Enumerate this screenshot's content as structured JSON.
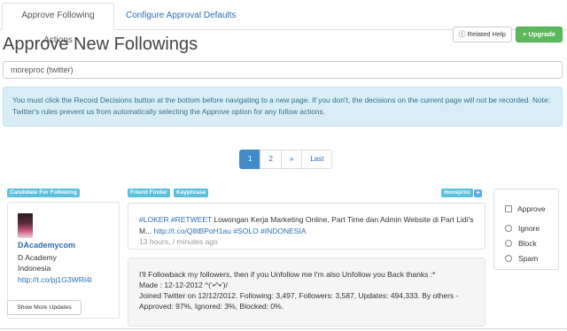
{
  "tabs": [
    {
      "label": "Approve Following Actions",
      "active": true
    },
    {
      "label": "Configure Approval Defaults",
      "active": false
    }
  ],
  "page_title": "Approve New Followings",
  "buttons": {
    "related_help": "Related Help",
    "upgrade": "Upgrade"
  },
  "account_select": {
    "value": "moreproc (twitter)"
  },
  "alert_text": "You must click the Record Decisions button at the bottom before navigating to a new page. If you don't, the decisions on the current page will not be recorded. Note: Twitter's rules prevent us from automatically selecting the Approve option for any follow actions.",
  "pagination": {
    "current": "1",
    "next_page": "2",
    "next": "»",
    "last": "Last"
  },
  "labels": {
    "candidate": "Candidate For Following",
    "friend_finder": "Friend Finder",
    "keyphrase": "Keyphrase",
    "account": "moreproc"
  },
  "candidate": {
    "screen_name": "DAcademycom",
    "name": "D Academy",
    "location": "Indonesia",
    "url": "http://t.co/pj1G3WRl4l",
    "show_more": "Show More Updates"
  },
  "tweet": {
    "hashtags_start": "#LOKER #RETWEET",
    "text": " Lowongan Kerja Marketing Online, Part Time dan Admin Website di Part Lidi's M... ",
    "link": "http://t.co/Q8tBPoH1au",
    "hashtags_end": "#SOLO #INDONESIA",
    "meta": "13 hours, / minutes ago"
  },
  "bio": {
    "line1": "I'll Followback my followers, then if you Unfollow me I'm also Unfollow you Back thanks :*",
    "line2": "Made : 12-12-2012 ^(‘•^•’)/",
    "stats": "Joined Twitter on 12/12/2012. Following: 3,497, Followers: 3,587, Updates: 494,333. By others - Approved: 97%, Ignored: 3%, Blocked: 0%."
  },
  "decisions": {
    "approve": "Approve",
    "ignore": "Ignore",
    "block": "Block",
    "spam": "Spam"
  },
  "icons": {
    "help": "info-circle-icon",
    "upgrade": "plus-icon",
    "twitter": "twitter-bird-icon"
  },
  "colors": {
    "primary": "#428bca",
    "success": "#5cb85c",
    "info_label": "#5bc0de",
    "alert_bg": "#d9edf7",
    "alert_text": "#31708f",
    "link": "#2a6fb5"
  }
}
